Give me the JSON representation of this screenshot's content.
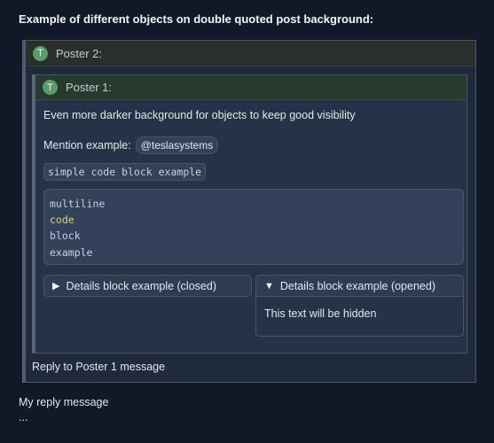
{
  "post": {
    "title": "Example of different objects on double quoted post background:"
  },
  "outer_quote": {
    "avatar_letter": "T",
    "poster": "Poster 2:",
    "reply": "Reply to Poster 1 message"
  },
  "inner_quote": {
    "avatar_letter": "T",
    "poster": "Poster 1:",
    "text": "Even more darker background for objects to keep good visibility",
    "mention_label": "Mention example:",
    "mention": "@teslasystems",
    "inline_code": "simple code block example",
    "code_lines": [
      "multiline",
      "code",
      "block",
      "example"
    ],
    "details_closed": {
      "summary": "Details block example (closed)",
      "icon": "triangle-right-icon"
    },
    "details_opened": {
      "summary": "Details block example (opened)",
      "icon": "triangle-down-icon",
      "body": "This text will be hidden"
    }
  },
  "my_reply": {
    "line1": "My reply message",
    "line2": "..."
  },
  "colors": {
    "page_bg": "#111827",
    "outer_header_bg": "#2a2f2c",
    "inner_header_bg": "#263a30",
    "avatar_bg": "#5a9a6b",
    "code_keyword": "#d6d869"
  }
}
